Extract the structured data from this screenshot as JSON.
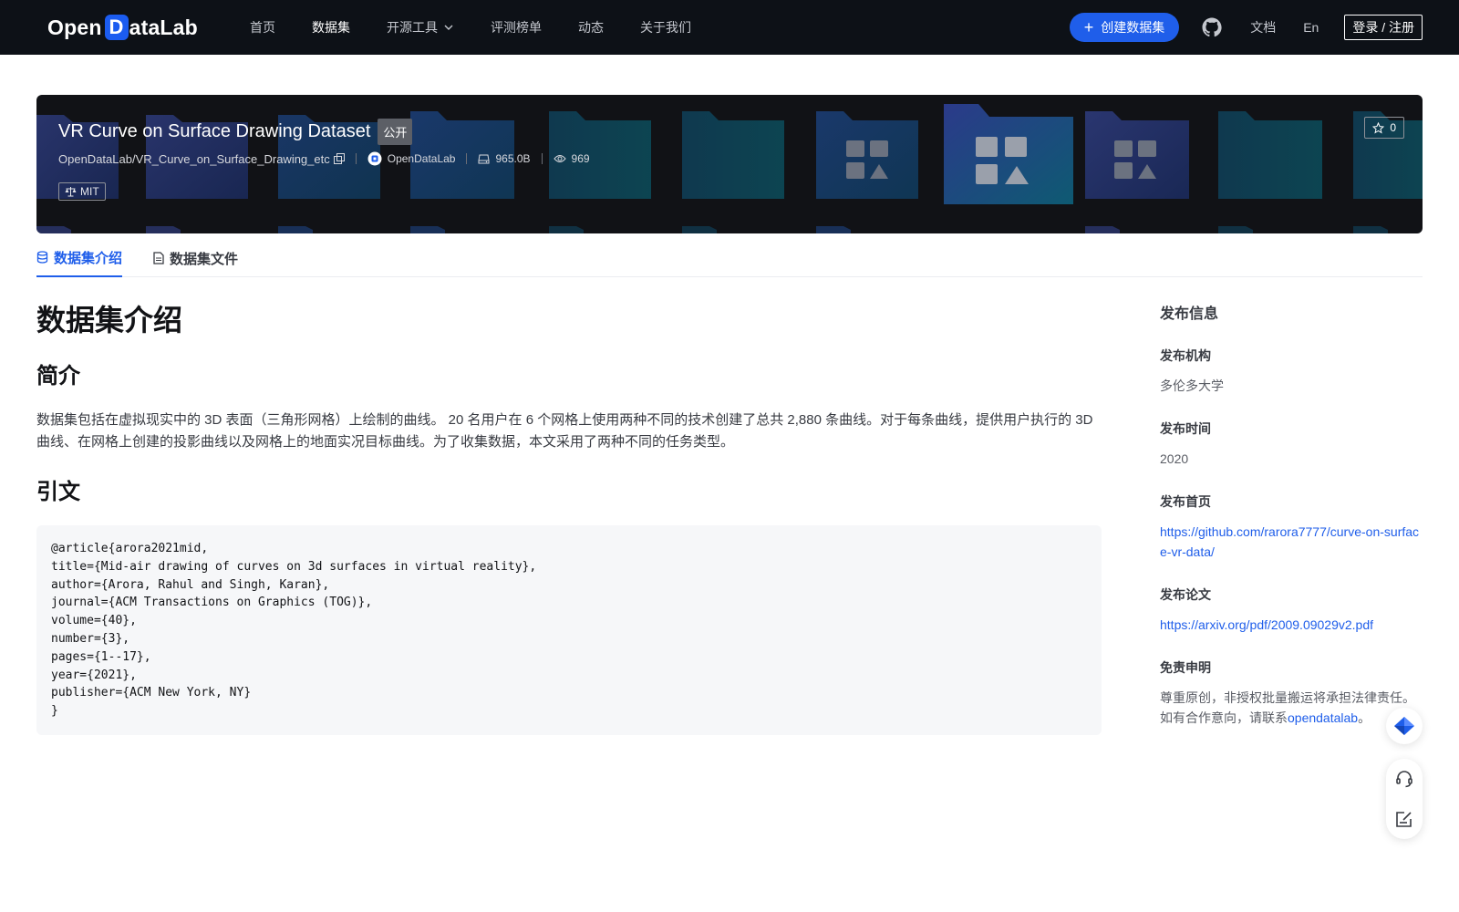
{
  "nav": {
    "logo_pre": "Open",
    "logo_d": "D",
    "logo_post": "ataLab",
    "items": [
      {
        "label": "首页",
        "active": false
      },
      {
        "label": "数据集",
        "active": true
      },
      {
        "label": "开源工具",
        "active": false,
        "dropdown": true
      },
      {
        "label": "评测榜单",
        "active": false
      },
      {
        "label": "动态",
        "active": false
      },
      {
        "label": "关于我们",
        "active": false
      }
    ],
    "create_label": "创建数据集",
    "docs_label": "文档",
    "lang_label": "En",
    "login_label": "登录 / 注册"
  },
  "banner": {
    "title": "VR Curve on Surface Drawing Dataset",
    "visibility": "公开",
    "repo": "OpenDataLab/VR_Curve_on_Surface_Drawing_etc",
    "publisher": "OpenDataLab",
    "size": "965.0B",
    "views": "969",
    "license": "MIT",
    "stars": "0"
  },
  "tabs": [
    {
      "label": "数据集介绍",
      "active": true,
      "icon": "database-icon"
    },
    {
      "label": "数据集文件",
      "active": false,
      "icon": "file-icon"
    }
  ],
  "main": {
    "heading": "数据集介绍",
    "intro_heading": "简介",
    "intro_text": "数据集包括在虚拟现实中的 3D 表面（三角形网格）上绘制的曲线。 20 名用户在 6 个网格上使用两种不同的技术创建了总共 2,880 条曲线。对于每条曲线，提供用户执行的 3D 曲线、在网格上创建的投影曲线以及网格上的地面实况目标曲线。为了收集数据，本文采用了两种不同的任务类型。",
    "citation_heading": "引文",
    "citation": "@article{arora2021mid,\ntitle={Mid-air drawing of curves on 3d surfaces in virtual reality},\nauthor={Arora, Rahul and Singh, Karan},\njournal={ACM Transactions on Graphics (TOG)},\nvolume={40},\nnumber={3},\npages={1--17},\nyear={2021},\npublisher={ACM New York, NY}\n}"
  },
  "sidebar": {
    "heading": "发布信息",
    "org_label": "发布机构",
    "org_value": "多伦多大学",
    "time_label": "发布时间",
    "time_value": "2020",
    "home_label": "发布首页",
    "home_value": "https://github.com/rarora7777/curve-on-surface-vr-data/",
    "paper_label": "发布论文",
    "paper_value": "https://arxiv.org/pdf/2009.09029v2.pdf",
    "disclaimer_label": "免责申明",
    "disclaimer_line1": "尊重原创，非授权批量搬运将承担法律责任。",
    "disclaimer_line2_pre": "如有合作意向，请联系",
    "disclaimer_link": "opendatalab",
    "disclaimer_line2_post": "。"
  },
  "colors": {
    "nav_bg": "#0d1117",
    "accent": "#1f5eea",
    "banner_bg": "#111216"
  }
}
